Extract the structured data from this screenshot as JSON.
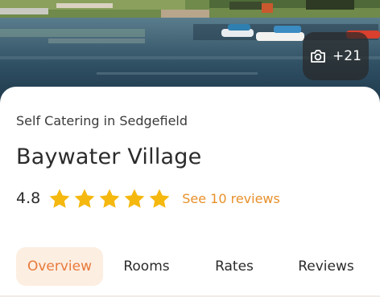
{
  "hero": {
    "photo_count_label": "+21",
    "camera_icon": "camera-icon"
  },
  "property": {
    "breadcrumb": "Self Catering in Sedgefield",
    "title": "Baywater Village",
    "rating": "4.8",
    "star_count": 5,
    "reviews_link": "See 10 reviews"
  },
  "tabs": [
    {
      "label": "Overview",
      "active": true
    },
    {
      "label": "Rooms",
      "active": false
    },
    {
      "label": "Rates",
      "active": false
    },
    {
      "label": "Reviews",
      "active": false
    }
  ],
  "colors": {
    "accent": "#e87a3a",
    "star": "#f5b80f",
    "link": "#e8902a",
    "active_tab_bg": "#fdeee2"
  }
}
